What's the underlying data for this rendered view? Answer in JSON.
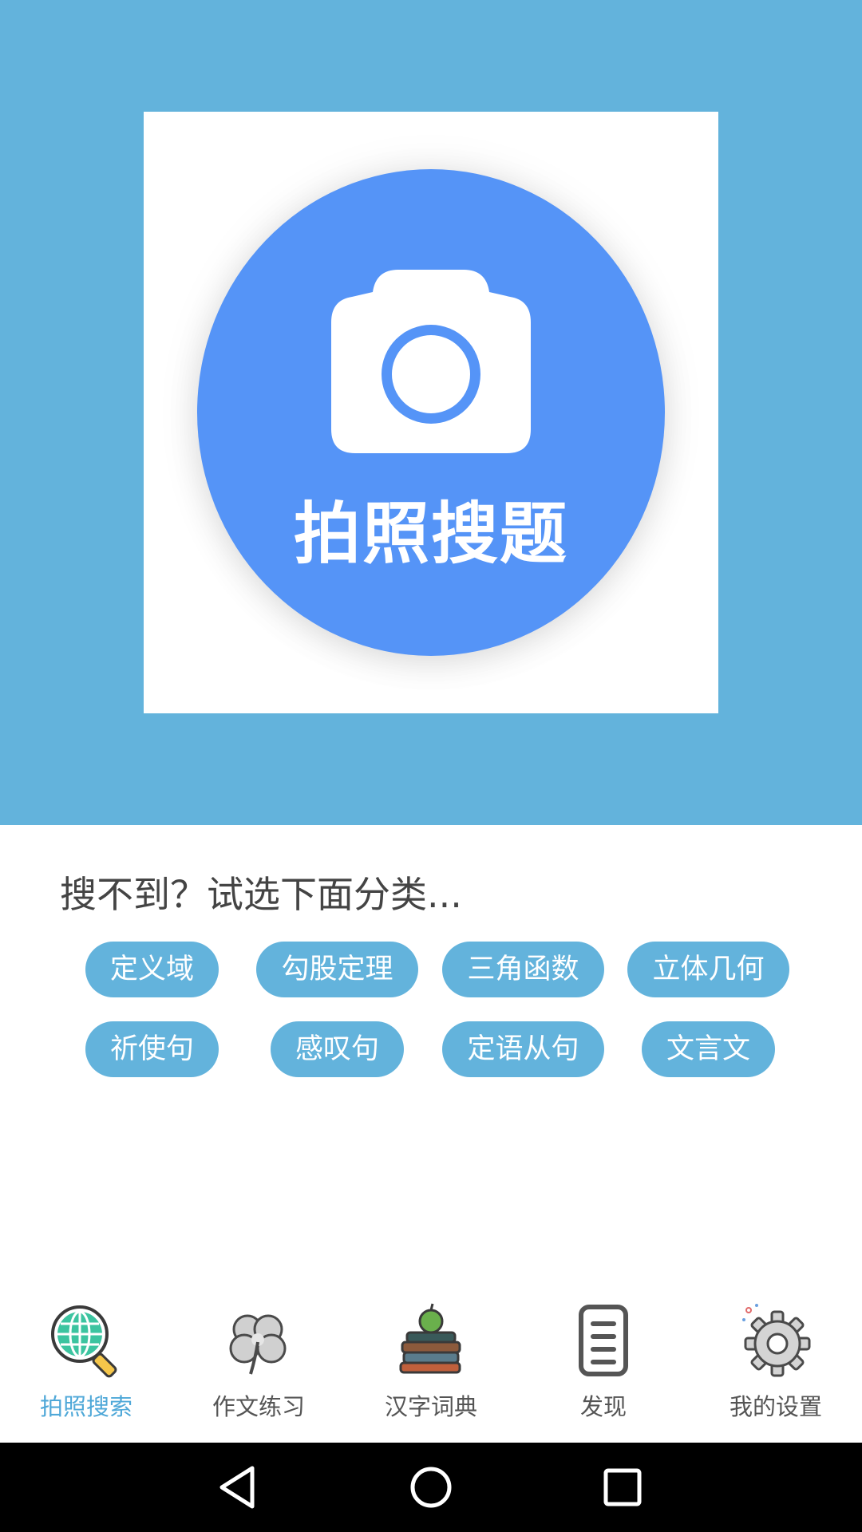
{
  "hero": {
    "button_label": "拍照搜题"
  },
  "prompt": "搜不到？试选下面分类...",
  "categories": [
    "定义域",
    "勾股定理",
    "三角函数",
    "立体几何",
    "祈使句",
    "感叹句",
    "定语从句",
    "文言文"
  ],
  "tabs": [
    {
      "label": "拍照搜索",
      "icon": "globe-magnifier-icon"
    },
    {
      "label": "作文练习",
      "icon": "clover-icon"
    },
    {
      "label": "汉字词典",
      "icon": "books-apple-icon"
    },
    {
      "label": "发现",
      "icon": "document-icon"
    },
    {
      "label": "我的设置",
      "icon": "gear-icon"
    }
  ],
  "colors": {
    "hero_bg": "#63b3dc",
    "circle": "#5594f7",
    "chip": "#63b3dc",
    "active_tab": "#4fa8d8",
    "nav_bar": "#000000"
  }
}
